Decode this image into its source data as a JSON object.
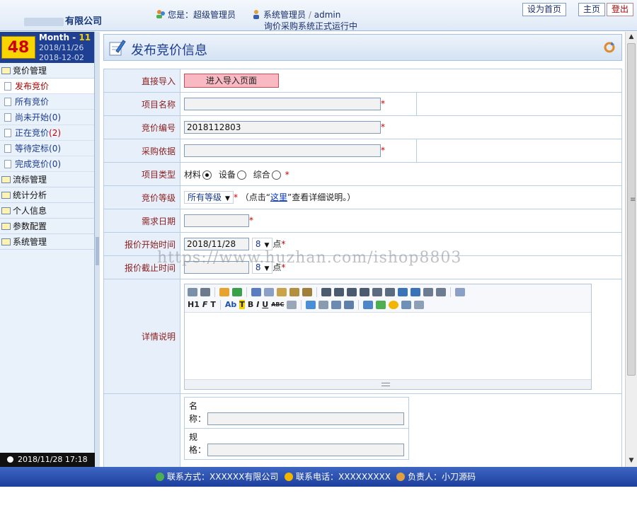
{
  "header": {
    "company": "有限公司",
    "welcome": "您是：超级管理员",
    "role": "系统管理员",
    "separator": "/",
    "username": "admin",
    "status_line": "询价采购系统正式运行中",
    "set_home_label": "设为首页",
    "home_label": "主页",
    "logout_label": "登出"
  },
  "sidebar": {
    "day_count": "48",
    "month_label": "Month -",
    "month_num": "11",
    "date_start": "2018/11/26",
    "date_end": "2018-12-02",
    "groups": [
      {
        "label": "竞价管理"
      },
      {
        "label": "流标管理"
      },
      {
        "label": "统计分析"
      },
      {
        "label": "个人信息"
      },
      {
        "label": "参数配置"
      },
      {
        "label": "系统管理"
      }
    ],
    "items": [
      {
        "label": "发布竞价",
        "count": ""
      },
      {
        "label": "所有竞价",
        "count": ""
      },
      {
        "label": "尚未开始",
        "count": "(0)"
      },
      {
        "label": "正在竞价",
        "count": "(2)"
      },
      {
        "label": "等待定标",
        "count": "(0)"
      },
      {
        "label": "完成竞价",
        "count": "(0)"
      }
    ],
    "clock": "2018/11/28  17:18"
  },
  "main": {
    "title": "发布竞价信息",
    "form": {
      "import_label": "直接导入",
      "import_button": "进入导入页面",
      "name_label": "项目名称",
      "name_value": "",
      "code_label": "竞价编号",
      "code_value": "2018112803",
      "basis_label": "采购依据",
      "basis_value": "",
      "type_label": "项目类型",
      "type_options": [
        "材料",
        "设备",
        "综合"
      ],
      "type_selected": "材料",
      "level_label": "竞价等级",
      "level_value": "所有等级",
      "level_hint_pre": "（点击“",
      "level_hint_link": "这里",
      "level_hint_post": "”查看详细说明。）",
      "demand_date_label": "需求日期",
      "demand_date_value": "",
      "start_label": "报价开始时间",
      "start_date": "2018/11/28",
      "start_hour": "8",
      "end_label": "报价截止时间",
      "end_date": "",
      "end_hour": "8",
      "hour_unit": "点",
      "detail_label": "详情说明",
      "required_mark": "*",
      "editor_row2": [
        "H1",
        "F",
        "T",
        "Ab",
        "T",
        "B",
        "I",
        "U",
        "ABC"
      ],
      "sub_name_label_a": "名",
      "sub_name_label_b": "称：",
      "sub_spec_label_a": "规",
      "sub_spec_label_b": "格："
    }
  },
  "footer": {
    "contact": "联系方式：XXXXXX有限公司",
    "phone": "联系电话：XXXXXXXXX",
    "owner": "负责人：小刀源码"
  },
  "watermark": "https://www.huzhan.com/ishop8803"
}
